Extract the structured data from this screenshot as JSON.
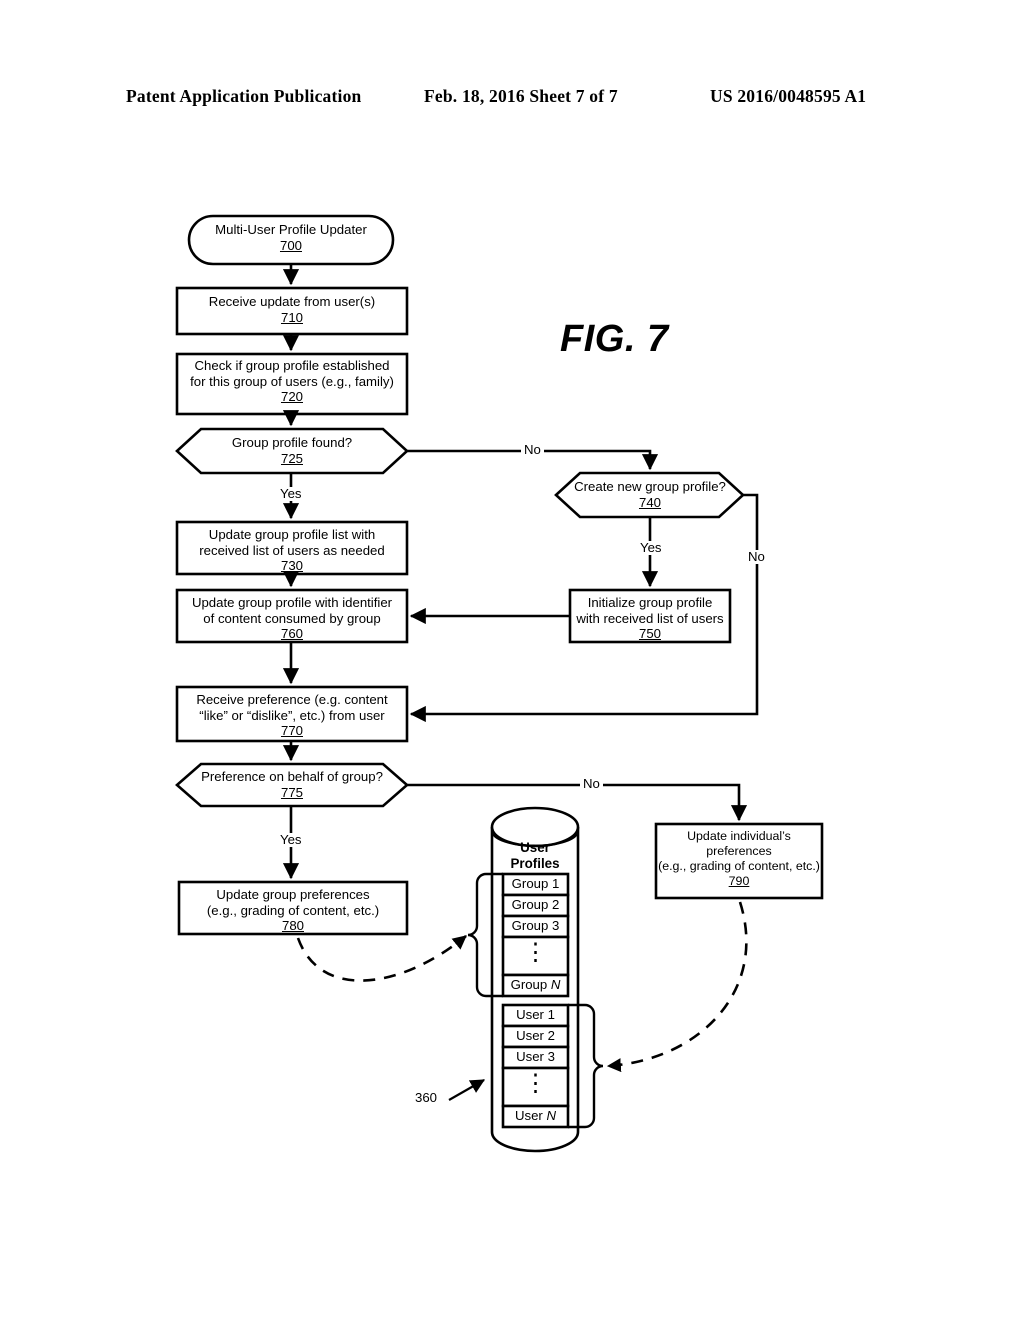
{
  "header": {
    "left": "Patent Application Publication",
    "middle": "Feb. 18, 2016  Sheet 7 of 7",
    "right": "US 2016/0048595 A1"
  },
  "figure": {
    "label": "FIG. 7"
  },
  "colors": {
    "ink": "#000000",
    "paper": "#ffffff"
  },
  "flowchart": {
    "nodes": [
      {
        "id": "700",
        "shape": "terminator",
        "lines": [
          "Multi-User Profile Updater"
        ],
        "ref": "700"
      },
      {
        "id": "710",
        "shape": "process",
        "lines": [
          "Receive update from user(s)"
        ],
        "ref": "710"
      },
      {
        "id": "720",
        "shape": "process",
        "lines": [
          "Check if group profile established",
          "for this group of users (e.g., family)"
        ],
        "ref": "720"
      },
      {
        "id": "725",
        "shape": "decision",
        "lines": [
          "Group profile found?"
        ],
        "ref": "725"
      },
      {
        "id": "730",
        "shape": "process",
        "lines": [
          "Update group profile list with",
          "received list of users as needed"
        ],
        "ref": "730"
      },
      {
        "id": "760",
        "shape": "process",
        "lines": [
          "Update group profile with identifier",
          "of content consumed by group"
        ],
        "ref": "760"
      },
      {
        "id": "770",
        "shape": "process",
        "lines": [
          "Receive preference (e.g. content",
          "“like” or “dislike”, etc.) from user"
        ],
        "ref": "770"
      },
      {
        "id": "775",
        "shape": "decision",
        "lines": [
          "Preference on behalf of group?"
        ],
        "ref": "775"
      },
      {
        "id": "780",
        "shape": "process",
        "lines": [
          "Update group preferences",
          "(e.g., grading of content, etc.)"
        ],
        "ref": "780"
      },
      {
        "id": "740",
        "shape": "decision",
        "lines": [
          "Create new group profile?"
        ],
        "ref": "740"
      },
      {
        "id": "750",
        "shape": "process",
        "lines": [
          "Initialize group profile",
          "with received list of users"
        ],
        "ref": "750"
      },
      {
        "id": "790",
        "shape": "process",
        "lines": [
          "Update individual’s",
          "preferences",
          "(e.g., grading of content, etc.)"
        ],
        "ref": "790"
      }
    ],
    "edge_labels": {
      "no_725": "No",
      "yes_725": "Yes",
      "yes_740": "Yes",
      "no_740": "No",
      "no_775": "No",
      "yes_775": "Yes"
    }
  },
  "database": {
    "ref": "360",
    "title_lines": [
      "User",
      "Profiles"
    ],
    "group_slots": [
      "Group 1",
      "Group 2",
      "Group 3",
      "⋮",
      "Group N"
    ],
    "user_slots": [
      "User 1",
      "User 2",
      "User 3",
      "⋮",
      "User N"
    ]
  }
}
